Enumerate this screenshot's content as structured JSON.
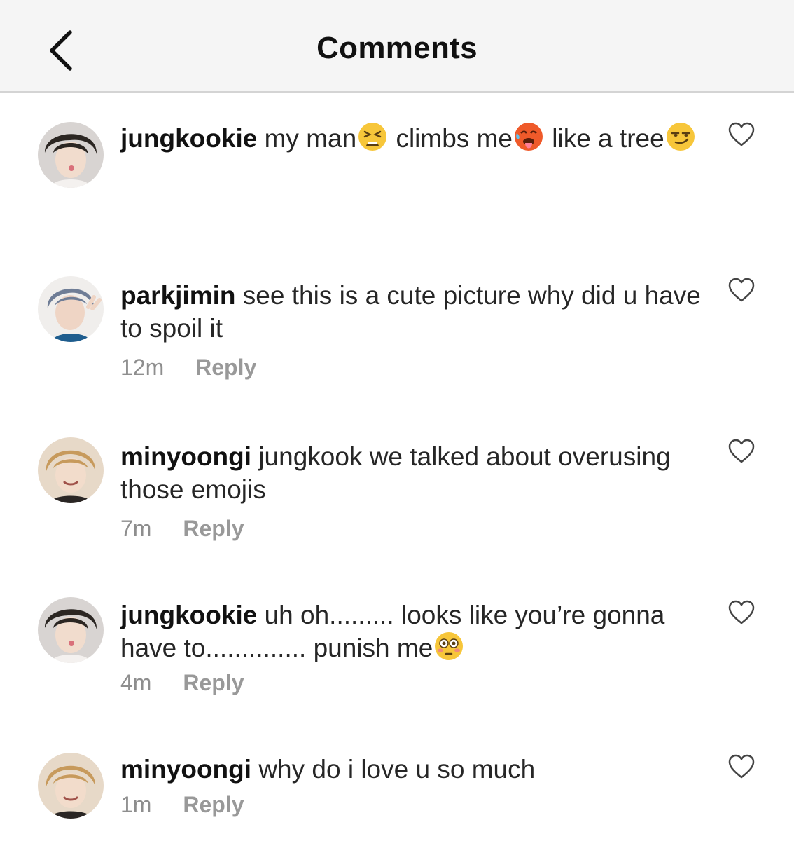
{
  "header": {
    "title": "Comments",
    "back_icon": "chevron-left-icon"
  },
  "comments": [
    {
      "username": "jungkookie",
      "text_parts": [
        "my man",
        " climbs me",
        " like a tree"
      ],
      "emojis": [
        "tired-face-emoji",
        "hot-face-emoji",
        "smirking-face-emoji"
      ],
      "time": "",
      "reply": ""
    },
    {
      "username": "parkjimin",
      "text": "see this is a cute picture why did u have to spoil it",
      "time": "12m",
      "reply": "Reply"
    },
    {
      "username": "minyoongi",
      "text": "jungkook we talked about overusing those emojis",
      "time": "7m",
      "reply": "Reply"
    },
    {
      "username": "jungkookie",
      "text": "uh oh......... looks like you’re gonna have to.............. punish me",
      "emojis": [
        "flushed-face-emoji"
      ],
      "time": "4m",
      "reply": "Reply"
    },
    {
      "username": "minyoongi",
      "text": "why do i love u so much",
      "time": "1m",
      "reply": "Reply"
    }
  ],
  "colors": {
    "header_bg": "#f5f5f5",
    "text": "#262626",
    "muted": "#8e8e8e",
    "emoji_yellow": "#f7c63a",
    "emoji_red": "#ef5a2a"
  }
}
